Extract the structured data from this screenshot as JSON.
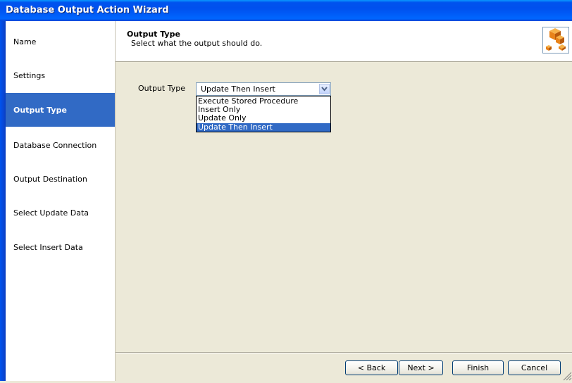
{
  "window": {
    "title": "Database Output Action Wizard"
  },
  "sidebar": {
    "items": [
      {
        "label": "Name",
        "active": false
      },
      {
        "label": "Settings",
        "active": false
      },
      {
        "label": "Output Type",
        "active": true
      },
      {
        "label": "Database Connection",
        "active": false
      },
      {
        "label": "Output Destination",
        "active": false
      },
      {
        "label": "Select Update Data",
        "active": false
      },
      {
        "label": "Select Insert Data",
        "active": false
      }
    ]
  },
  "header": {
    "title": "Output Type",
    "subtitle": "Select what the output should do.",
    "icon": "cubes-icon"
  },
  "form": {
    "output_type_label": "Output Type",
    "output_type_value": "Update Then Insert",
    "options": [
      "Execute Stored Procedure",
      "Insert Only",
      "Update Only",
      "Update Then Insert"
    ],
    "selected_index": 3
  },
  "buttons": {
    "back": "< Back",
    "next": "Next >",
    "finish": "Finish",
    "cancel": "Cancel"
  },
  "colors": {
    "title_bar": "#0053ee",
    "selection": "#316ac5",
    "icon_orange": "#e8831a"
  }
}
